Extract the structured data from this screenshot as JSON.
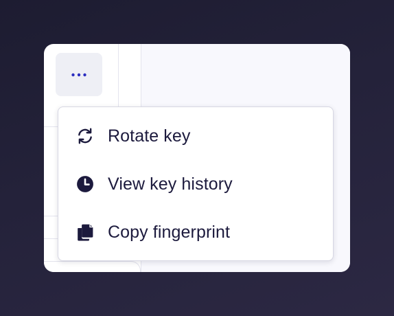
{
  "colors": {
    "backdrop": "#1f1e34",
    "card": "#ffffff",
    "pane": "#f8f8fd",
    "button_bg": "#eeeff5",
    "accent": "#2b2dbf",
    "text": "#1c1a3d"
  },
  "more_button": {
    "icon": "more-horizontal-icon"
  },
  "menu": {
    "items": [
      {
        "label": "Rotate key",
        "icon": "rotate-icon"
      },
      {
        "label": "View key history",
        "icon": "clock-icon"
      },
      {
        "label": "Copy fingerprint",
        "icon": "copy-icon"
      }
    ]
  }
}
